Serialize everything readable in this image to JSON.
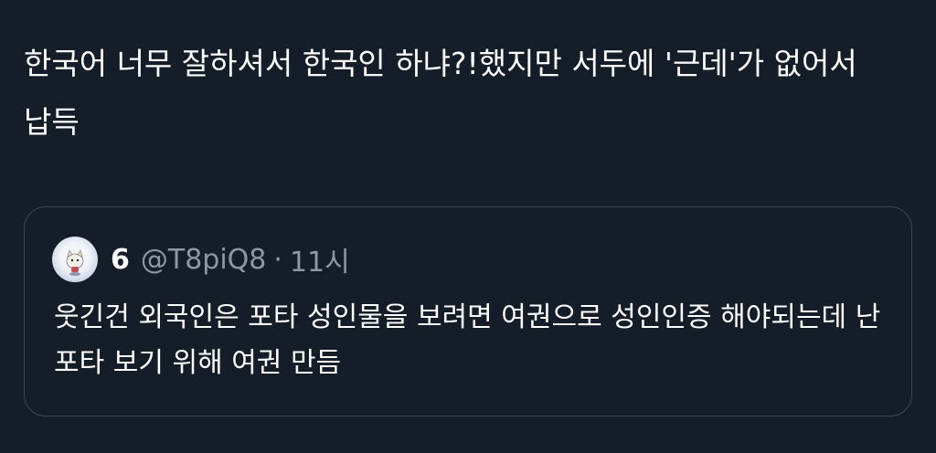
{
  "tweet": {
    "text": "한국어 너무 잘하셔서 한국인 하냐?!했지만 서두에 '근데'가 없어서 납득"
  },
  "quoted_tweet": {
    "author_name": "6",
    "author_handle": "@T8piQ8",
    "separator": "·",
    "time": "11시",
    "avatar_icon": "cartoon-character-avatar",
    "text": "웃긴건 외국인은 포타 성인물을 보려면 여권으로 성인인증 해야되는데 난 포타 보기 위해 여권 만듬"
  },
  "colors": {
    "background": "#151d28",
    "text": "#ffffff",
    "secondary_text": "#8b98a5",
    "card_border": "#3b4754"
  }
}
